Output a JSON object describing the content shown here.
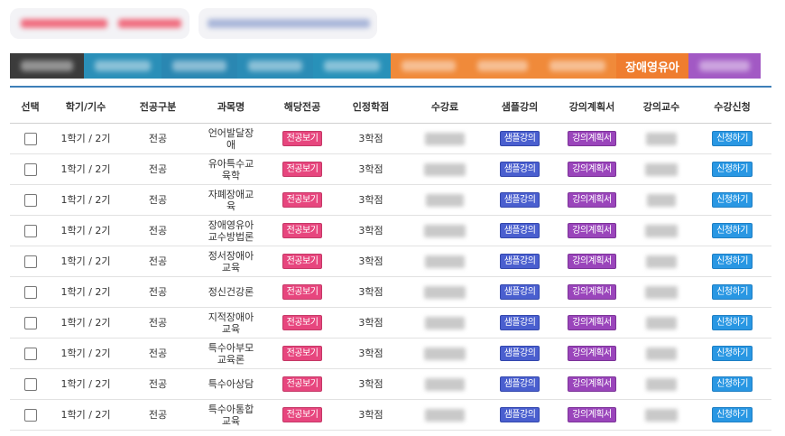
{
  "header": {
    "pills": [
      {
        "name": "blurred-text-pill-1",
        "colors": [
          "#f06d7f",
          "#f7aab4"
        ]
      },
      {
        "name": "blurred-text-pill-2",
        "colors": [
          "#a9b6d9",
          "#c8d2ea"
        ]
      }
    ]
  },
  "tabs": [
    {
      "label": "",
      "color": "#3b3b3b"
    },
    {
      "label": "",
      "color": "#2a8fb8"
    },
    {
      "label": "",
      "color": "#2a87b2"
    },
    {
      "label": "",
      "color": "#2a8cb6"
    },
    {
      "label": "",
      "color": "#2891b9"
    },
    {
      "label": "",
      "color": "#f08a3a"
    },
    {
      "label": "",
      "color": "#f08a3a"
    },
    {
      "label": "",
      "color": "#f08a3a"
    },
    {
      "label": "장애영유아",
      "color": "#ef7d2f"
    },
    {
      "label": "",
      "color": "#a259c4"
    }
  ],
  "table": {
    "headers": [
      "선택",
      "학기/기수",
      "전공구분",
      "과목명",
      "해당전공",
      "인정학점",
      "수강료",
      "샘플강의",
      "강의계획서",
      "강의교수",
      "수강신청"
    ],
    "buttons": {
      "major": "전공보기",
      "sample": "샘플강의",
      "plan": "강의계획서",
      "apply": "신청하기"
    },
    "rows": [
      {
        "term": "1학기 / 2기",
        "category": "전공",
        "subject": "언어발달장애",
        "credits": "3학점"
      },
      {
        "term": "1학기 / 2기",
        "category": "전공",
        "subject": "유아특수교육학",
        "credits": "3학점"
      },
      {
        "term": "1학기 / 2기",
        "category": "전공",
        "subject": "자폐장애교육",
        "credits": "3학점"
      },
      {
        "term": "1학기 / 2기",
        "category": "전공",
        "subject": "장애영유아교수방법론",
        "credits": "3학점"
      },
      {
        "term": "1학기 / 2기",
        "category": "전공",
        "subject": "정서장애아교육",
        "credits": "3학점"
      },
      {
        "term": "1학기 / 2기",
        "category": "전공",
        "subject": "정신건강론",
        "credits": "3학점"
      },
      {
        "term": "1학기 / 2기",
        "category": "전공",
        "subject": "지적장애아교육",
        "credits": "3학점"
      },
      {
        "term": "1학기 / 2기",
        "category": "전공",
        "subject": "특수아부모교육론",
        "credits": "3학점"
      },
      {
        "term": "1학기 / 2기",
        "category": "전공",
        "subject": "특수아상담",
        "credits": "3학점"
      },
      {
        "term": "1학기 / 2기",
        "category": "전공",
        "subject": "특수아통합교육",
        "credits": "3학점"
      }
    ]
  }
}
